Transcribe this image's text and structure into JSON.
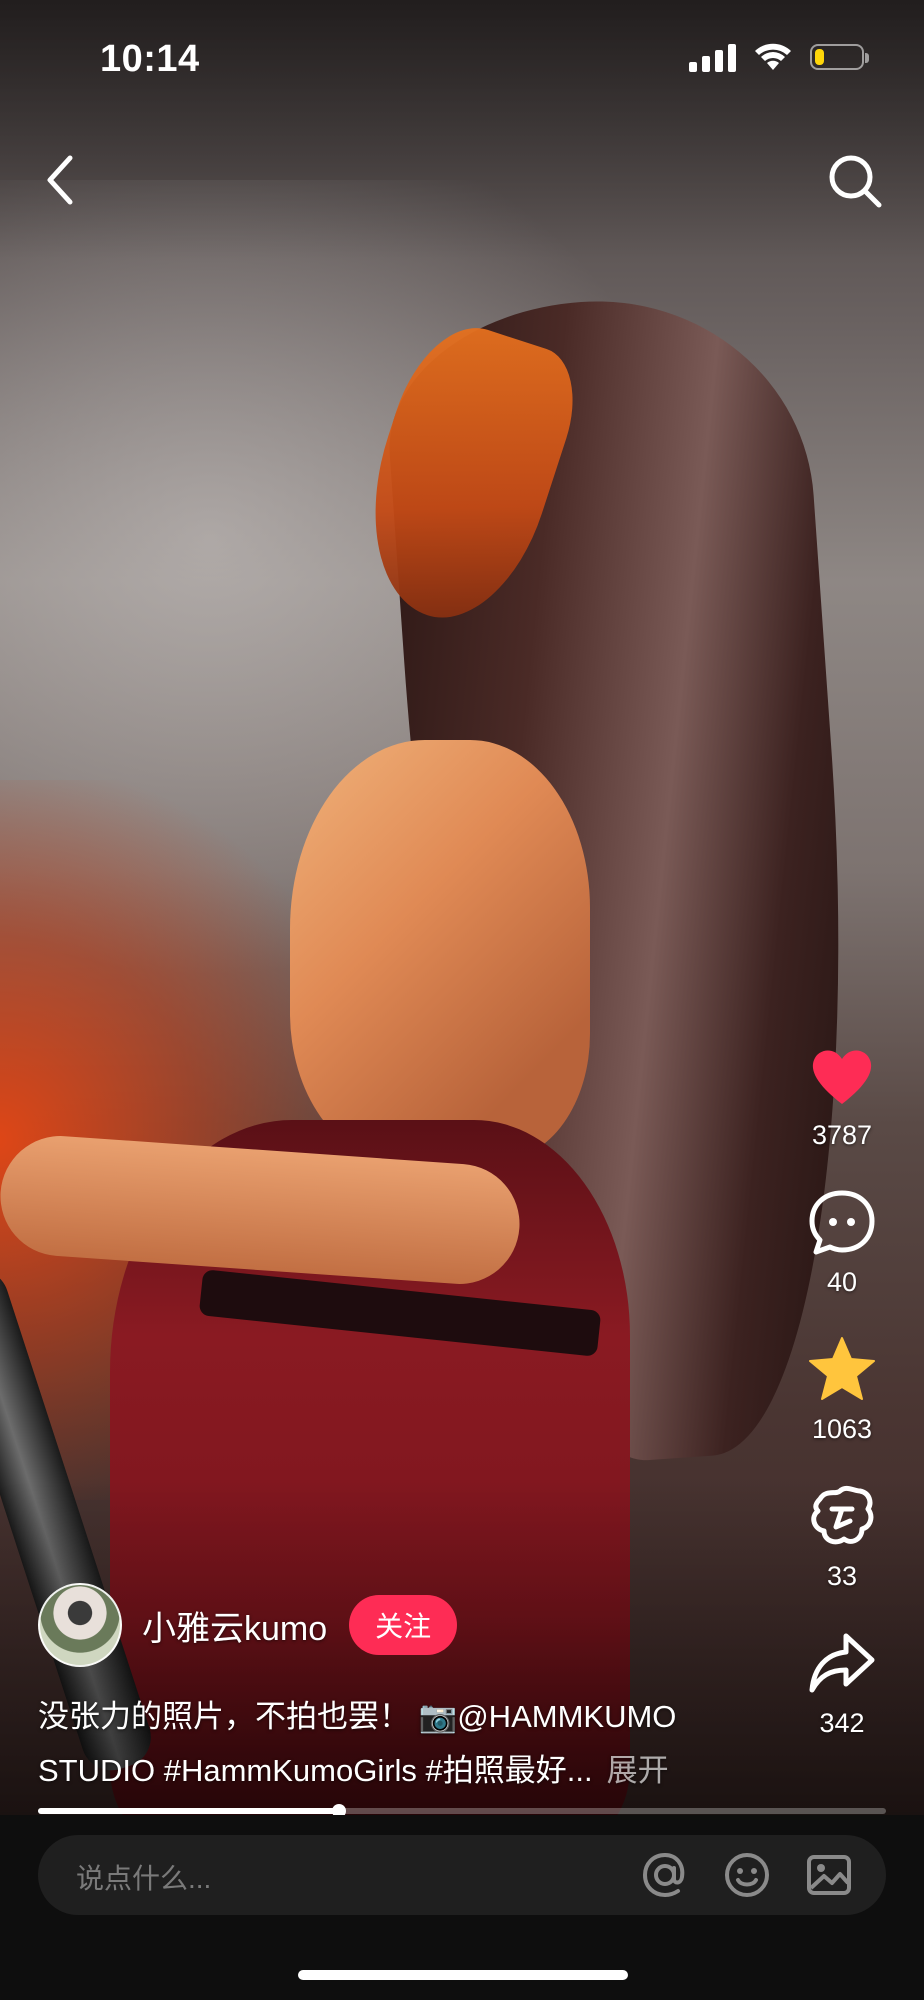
{
  "status_bar": {
    "time": "10:14",
    "battery_level": 0.2,
    "battery_color": "#ffd60a",
    "icons": [
      "signal-icon",
      "wifi-icon",
      "battery-icon"
    ]
  },
  "nav": {
    "back_icon": "chevron-left-icon",
    "search_icon": "search-icon"
  },
  "actions": {
    "like": {
      "icon": "heart-icon",
      "count": "3787",
      "color": "#fe2c55"
    },
    "comment": {
      "icon": "comment-icon",
      "count": "40"
    },
    "favorite": {
      "icon": "star-icon",
      "count": "1063",
      "color": "#ffc53d"
    },
    "boost": {
      "icon": "boost-icon",
      "count": "33"
    },
    "share": {
      "icon": "share-icon",
      "count": "342"
    }
  },
  "author": {
    "name": "小雅云kumo",
    "follow_label": "关注"
  },
  "caption": {
    "line1": "没张力的照片，不拍也罢！ 📷@HAMMKUMO",
    "line2": "STUDIO #HammKumoGirls  #拍照最好...",
    "more": "展开"
  },
  "progress": {
    "value": 0.355
  },
  "comment_bar": {
    "placeholder": "说点什么...",
    "icons": [
      "at-icon",
      "emoji-icon",
      "image-icon"
    ]
  }
}
